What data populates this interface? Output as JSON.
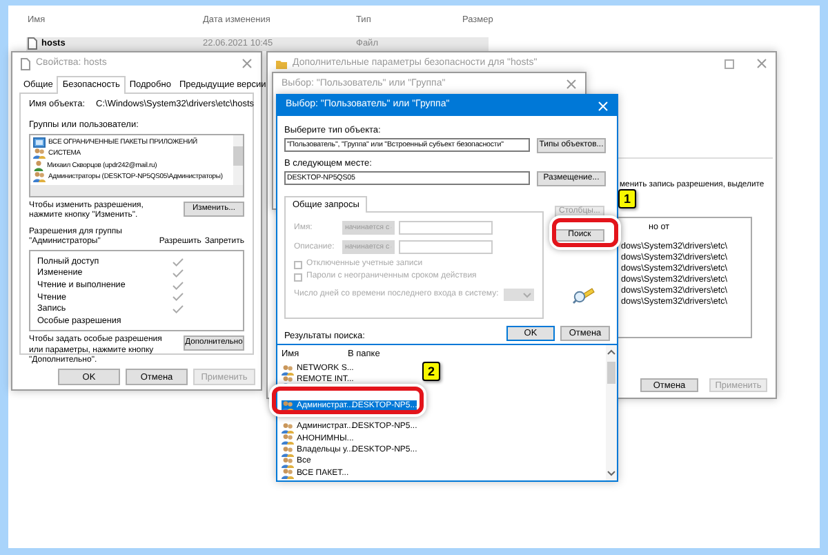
{
  "explorer": {
    "columns": [
      "Имя",
      "Дата изменения",
      "Тип",
      "Размер"
    ],
    "rows": [
      {
        "name": "hosts",
        "date": "22.06.2021 10:45",
        "type": "Файл",
        "selected": true
      }
    ]
  },
  "properties_window": {
    "title": "Свойства: hosts",
    "tabs": [
      {
        "label": "Общие",
        "selected": false
      },
      {
        "label": "Безопасность",
        "selected": true
      },
      {
        "label": "Подробно",
        "selected": false
      },
      {
        "label": "Предыдущие версии",
        "selected": false
      }
    ],
    "object_label": "Имя объекта:",
    "object_path": "C:\\Windows\\System32\\drivers\\etc\\hosts",
    "groups_label": "Группы или пользователи:",
    "groups": [
      {
        "name": "ВСЕ ОГРАНИЧЕННЫЕ ПАКЕТЫ ПРИЛОЖЕНИЙ",
        "kind": "package"
      },
      {
        "name": "СИСТЕМА",
        "kind": "group"
      },
      {
        "name": "Михаил Скворцов (updr242@mail.ru)",
        "kind": "user"
      },
      {
        "name": "Администраторы (DESKTOP-NP5QS05\\Администраторы)",
        "kind": "group"
      }
    ],
    "change_hint": "Чтобы изменить разрешения, нажмите кнопку \"Изменить\".",
    "change_button": "Изменить...",
    "permissions_label": "Разрешения для группы\n\"Администраторы\"",
    "permission_columns": [
      "Разрешить",
      "Запретить"
    ],
    "permissions": [
      {
        "name": "Полный доступ",
        "allow": true
      },
      {
        "name": "Изменение",
        "allow": true
      },
      {
        "name": "Чтение и выполнение",
        "allow": true
      },
      {
        "name": "Чтение",
        "allow": true
      },
      {
        "name": "Запись",
        "allow": true
      },
      {
        "name": "Особые разрешения",
        "allow": false
      }
    ],
    "advanced_hint": "Чтобы задать особые разрешения или параметры, нажмите кнопку \"Дополнительно\".",
    "advanced_button": "Дополнительно",
    "buttons": [
      {
        "label": "OK",
        "disabled": false
      },
      {
        "label": "Отмена",
        "disabled": false
      },
      {
        "label": "Применить",
        "disabled": true
      }
    ]
  },
  "advanced_window": {
    "title": "Дополнительные параметры безопасности для \"hosts\"",
    "hint": "менить запись разрешения, выделите",
    "list_header": "но от",
    "paths": [
      "dows\\System32\\drivers\\etc\\",
      "dows\\System32\\drivers\\etc\\",
      "dows\\System32\\drivers\\etc\\",
      "dows\\System32\\drivers\\etc\\",
      "dows\\System32\\drivers\\etc\\",
      "dows\\System32\\drivers\\etc\\"
    ],
    "buttons": [
      {
        "label": "Отмена",
        "disabled": false
      },
      {
        "label": "Применить",
        "disabled": true
      }
    ]
  },
  "back_dialog": {
    "title": "Выбор: \"Пользователь\" или \"Группа\""
  },
  "dialog": {
    "title": "Выбор: \"Пользователь\" или \"Группа\"",
    "type_label": "Выберите тип объекта:",
    "type_value": "\"Пользователь\", \"Группа\" или \"Встроенный субъект безопасности\"",
    "type_button": "Типы объектов...",
    "location_label": "В следующем месте:",
    "location_value": "DESKTOP-NP5QS05",
    "location_button": "Размещение...",
    "query_tab": "Общие запросы",
    "queries": [
      {
        "label": "Имя:",
        "condition": "начинается с",
        "disabled": true
      },
      {
        "label": "Описание:",
        "condition": "начинается с",
        "disabled": true
      }
    ],
    "checkboxes": [
      {
        "label": "Отключенные учетные записи",
        "checked": false,
        "disabled": true
      },
      {
        "label": "Пароли с неограниченным сроком действия",
        "checked": false,
        "disabled": true
      }
    ],
    "days_label": "Число дней со времени последнего входа в систему:",
    "side_buttons": [
      {
        "label": "Столбцы...",
        "disabled": true
      },
      {
        "label": "Поиск",
        "disabled": false
      }
    ],
    "results_label": "Результаты поиска:",
    "ok": "OK",
    "cancel": "Отмена",
    "result_columns": [
      "Имя",
      "В папке"
    ],
    "results": [
      {
        "name": "NETWORK S...",
        "selected": false
      },
      {
        "name": "REMOTE INT...",
        "selected": false
      },
      {
        "name": "Администрат...",
        "folder": "DESKTOP-NP5...",
        "selected": true
      },
      {
        "name": "Администрат...",
        "folder": "DESKTOP-NP5...",
        "selected": false
      },
      {
        "name": "АНОНИМНЫ...",
        "selected": false
      },
      {
        "name": "Владельцы у...",
        "folder": "DESKTOP-NP5...",
        "selected": false
      },
      {
        "name": "Все",
        "selected": false
      },
      {
        "name": "ВСЕ ПАКЕТ...",
        "selected": false
      }
    ]
  },
  "annotations": [
    {
      "number": "1"
    },
    {
      "number": "2"
    }
  ]
}
